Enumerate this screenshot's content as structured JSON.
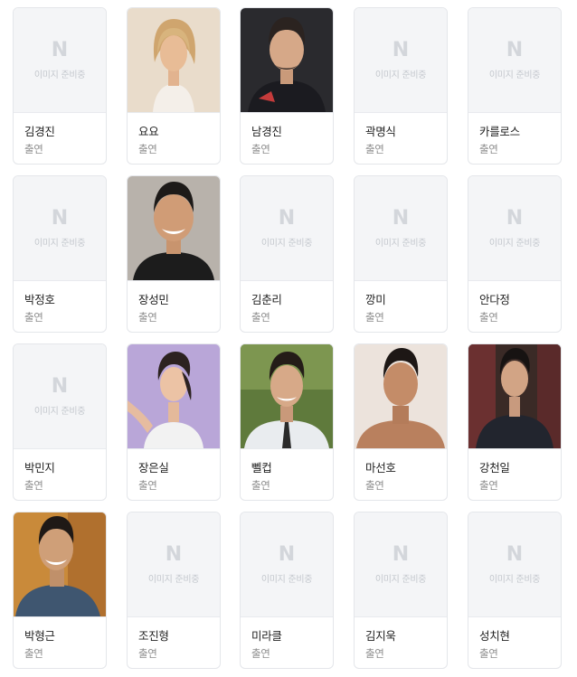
{
  "placeholder": {
    "logo": "N",
    "text": "이미지 준비중"
  },
  "cast": [
    {
      "name": "김경진",
      "role": "출연",
      "photo": false
    },
    {
      "name": "요요",
      "role": "출연",
      "photo": true,
      "icon": "person-photo-female-blonde"
    },
    {
      "name": "남경진",
      "role": "출연",
      "photo": true,
      "icon": "person-photo-male-fighter"
    },
    {
      "name": "곽명식",
      "role": "출연",
      "photo": false
    },
    {
      "name": "카를로스",
      "role": "출연",
      "photo": false
    },
    {
      "name": "박정호",
      "role": "출연",
      "photo": false
    },
    {
      "name": "장성민",
      "role": "출연",
      "photo": true,
      "icon": "person-photo-male-smiling"
    },
    {
      "name": "김춘리",
      "role": "출연",
      "photo": false
    },
    {
      "name": "깡미",
      "role": "출연",
      "photo": false
    },
    {
      "name": "안다정",
      "role": "출연",
      "photo": false
    },
    {
      "name": "박민지",
      "role": "출연",
      "photo": false
    },
    {
      "name": "장은실",
      "role": "출연",
      "photo": true,
      "icon": "person-photo-female-athlete"
    },
    {
      "name": "뻴컵",
      "role": "출연",
      "photo": true,
      "icon": "person-photo-male-shirt"
    },
    {
      "name": "마선호",
      "role": "출연",
      "photo": true,
      "icon": "person-photo-male-shirtless"
    },
    {
      "name": "강천일",
      "role": "출연",
      "photo": true,
      "icon": "person-photo-male-jacket"
    },
    {
      "name": "박형근",
      "role": "출연",
      "photo": true,
      "icon": "person-photo-male-denim"
    },
    {
      "name": "조진형",
      "role": "출연",
      "photo": false
    },
    {
      "name": "미라클",
      "role": "출연",
      "photo": false
    },
    {
      "name": "김지욱",
      "role": "출연",
      "photo": false
    },
    {
      "name": "성치현",
      "role": "출연",
      "photo": false
    }
  ]
}
